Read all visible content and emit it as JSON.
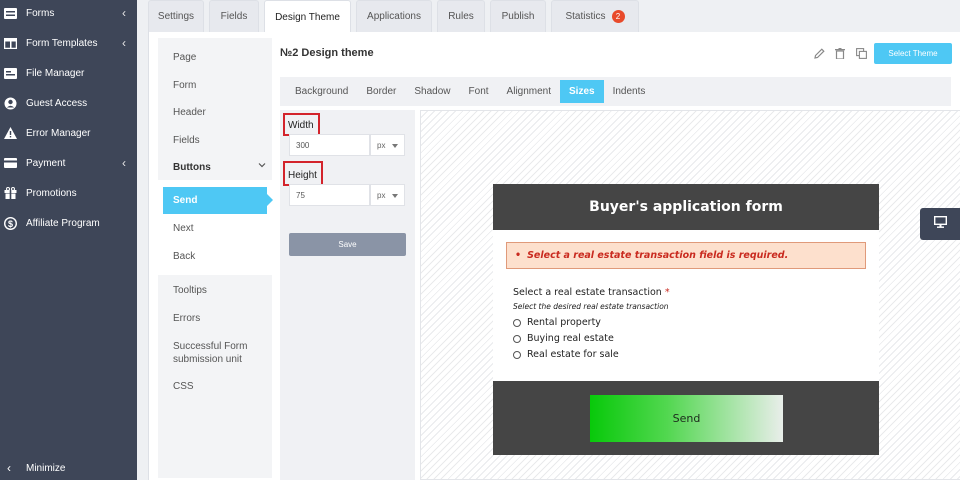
{
  "sidebar": {
    "items": [
      {
        "label": "Forms",
        "icon": "forms-icon",
        "chevron": "‹"
      },
      {
        "label": "Form Templates",
        "icon": "templates-icon",
        "chevron": "‹"
      },
      {
        "label": "File Manager",
        "icon": "file-manager-icon",
        "chevron": ""
      },
      {
        "label": "Guest Access",
        "icon": "guest-access-icon",
        "chevron": ""
      },
      {
        "label": "Error Manager",
        "icon": "warning-icon",
        "chevron": ""
      },
      {
        "label": "Payment",
        "icon": "payment-icon",
        "chevron": "‹"
      },
      {
        "label": "Promotions",
        "icon": "gift-icon",
        "chevron": ""
      },
      {
        "label": "Affiliate Program",
        "icon": "dollar-icon",
        "chevron": ""
      }
    ],
    "minimize_label": "Minimize"
  },
  "tabs": [
    {
      "label": "Settings"
    },
    {
      "label": "Fields"
    },
    {
      "label": "Design Theme",
      "active": true
    },
    {
      "label": "Applications"
    },
    {
      "label": "Rules"
    },
    {
      "label": "Publish"
    },
    {
      "label": "Statistics",
      "badge": "2"
    }
  ],
  "left_menu": {
    "items": [
      "Page",
      "Form",
      "Header",
      "Fields",
      "Buttons"
    ],
    "buttons_children": [
      "Send",
      "Next",
      "Back"
    ],
    "active_child": "Send",
    "more": [
      "Tooltips",
      "Errors",
      "Successful Form submission unit",
      "CSS"
    ]
  },
  "header": {
    "title": "№2 Design theme",
    "select_theme_label": "Select Theme"
  },
  "subtabs": [
    "Background",
    "Border",
    "Shadow",
    "Font",
    "Alignment",
    "Sizes",
    "Indents"
  ],
  "active_subtab": "Sizes",
  "size_settings": {
    "width_label": "Width",
    "width_value": "300",
    "width_unit": "px",
    "height_label": "Height",
    "height_value": "75",
    "height_unit": "px",
    "save_label": "Save"
  },
  "preview": {
    "form_title": "Buyer's application form",
    "error_bullet": "•",
    "error_text": "Select a real estate transaction field is required.",
    "question": "Select a real estate transaction",
    "required_mark": "*",
    "hint": "Select the desired real estate transaction",
    "options": [
      "Rental property",
      "Buying real estate",
      "Real estate for sale"
    ],
    "send_label": "Send"
  },
  "colors": {
    "sidebar_bg": "#3e4658",
    "accent": "#4ec8f4",
    "error_border": "#d3232b",
    "form_header_bg": "#454545"
  }
}
